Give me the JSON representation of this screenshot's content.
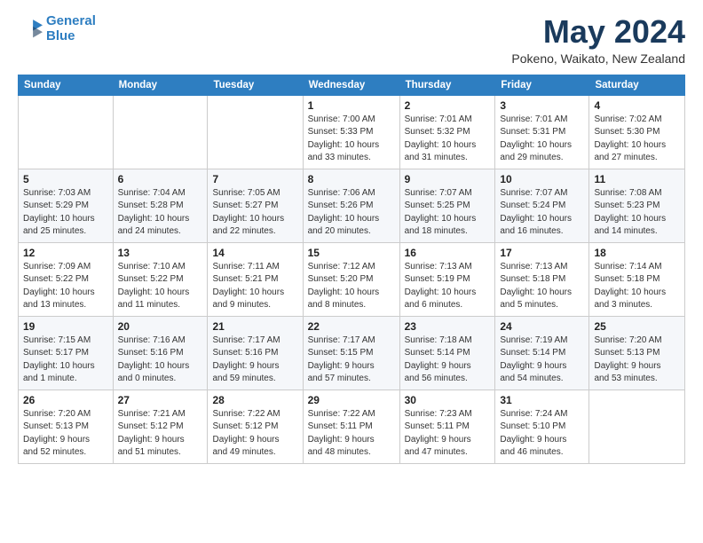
{
  "header": {
    "logo_line1": "General",
    "logo_line2": "Blue",
    "month": "May 2024",
    "location": "Pokeno, Waikato, New Zealand"
  },
  "days_of_week": [
    "Sunday",
    "Monday",
    "Tuesday",
    "Wednesday",
    "Thursday",
    "Friday",
    "Saturday"
  ],
  "weeks": [
    [
      {
        "day": "",
        "info": ""
      },
      {
        "day": "",
        "info": ""
      },
      {
        "day": "",
        "info": ""
      },
      {
        "day": "1",
        "info": "Sunrise: 7:00 AM\nSunset: 5:33 PM\nDaylight: 10 hours\nand 33 minutes."
      },
      {
        "day": "2",
        "info": "Sunrise: 7:01 AM\nSunset: 5:32 PM\nDaylight: 10 hours\nand 31 minutes."
      },
      {
        "day": "3",
        "info": "Sunrise: 7:01 AM\nSunset: 5:31 PM\nDaylight: 10 hours\nand 29 minutes."
      },
      {
        "day": "4",
        "info": "Sunrise: 7:02 AM\nSunset: 5:30 PM\nDaylight: 10 hours\nand 27 minutes."
      }
    ],
    [
      {
        "day": "5",
        "info": "Sunrise: 7:03 AM\nSunset: 5:29 PM\nDaylight: 10 hours\nand 25 minutes."
      },
      {
        "day": "6",
        "info": "Sunrise: 7:04 AM\nSunset: 5:28 PM\nDaylight: 10 hours\nand 24 minutes."
      },
      {
        "day": "7",
        "info": "Sunrise: 7:05 AM\nSunset: 5:27 PM\nDaylight: 10 hours\nand 22 minutes."
      },
      {
        "day": "8",
        "info": "Sunrise: 7:06 AM\nSunset: 5:26 PM\nDaylight: 10 hours\nand 20 minutes."
      },
      {
        "day": "9",
        "info": "Sunrise: 7:07 AM\nSunset: 5:25 PM\nDaylight: 10 hours\nand 18 minutes."
      },
      {
        "day": "10",
        "info": "Sunrise: 7:07 AM\nSunset: 5:24 PM\nDaylight: 10 hours\nand 16 minutes."
      },
      {
        "day": "11",
        "info": "Sunrise: 7:08 AM\nSunset: 5:23 PM\nDaylight: 10 hours\nand 14 minutes."
      }
    ],
    [
      {
        "day": "12",
        "info": "Sunrise: 7:09 AM\nSunset: 5:22 PM\nDaylight: 10 hours\nand 13 minutes."
      },
      {
        "day": "13",
        "info": "Sunrise: 7:10 AM\nSunset: 5:22 PM\nDaylight: 10 hours\nand 11 minutes."
      },
      {
        "day": "14",
        "info": "Sunrise: 7:11 AM\nSunset: 5:21 PM\nDaylight: 10 hours\nand 9 minutes."
      },
      {
        "day": "15",
        "info": "Sunrise: 7:12 AM\nSunset: 5:20 PM\nDaylight: 10 hours\nand 8 minutes."
      },
      {
        "day": "16",
        "info": "Sunrise: 7:13 AM\nSunset: 5:19 PM\nDaylight: 10 hours\nand 6 minutes."
      },
      {
        "day": "17",
        "info": "Sunrise: 7:13 AM\nSunset: 5:18 PM\nDaylight: 10 hours\nand 5 minutes."
      },
      {
        "day": "18",
        "info": "Sunrise: 7:14 AM\nSunset: 5:18 PM\nDaylight: 10 hours\nand 3 minutes."
      }
    ],
    [
      {
        "day": "19",
        "info": "Sunrise: 7:15 AM\nSunset: 5:17 PM\nDaylight: 10 hours\nand 1 minute."
      },
      {
        "day": "20",
        "info": "Sunrise: 7:16 AM\nSunset: 5:16 PM\nDaylight: 10 hours\nand 0 minutes."
      },
      {
        "day": "21",
        "info": "Sunrise: 7:17 AM\nSunset: 5:16 PM\nDaylight: 9 hours\nand 59 minutes."
      },
      {
        "day": "22",
        "info": "Sunrise: 7:17 AM\nSunset: 5:15 PM\nDaylight: 9 hours\nand 57 minutes."
      },
      {
        "day": "23",
        "info": "Sunrise: 7:18 AM\nSunset: 5:14 PM\nDaylight: 9 hours\nand 56 minutes."
      },
      {
        "day": "24",
        "info": "Sunrise: 7:19 AM\nSunset: 5:14 PM\nDaylight: 9 hours\nand 54 minutes."
      },
      {
        "day": "25",
        "info": "Sunrise: 7:20 AM\nSunset: 5:13 PM\nDaylight: 9 hours\nand 53 minutes."
      }
    ],
    [
      {
        "day": "26",
        "info": "Sunrise: 7:20 AM\nSunset: 5:13 PM\nDaylight: 9 hours\nand 52 minutes."
      },
      {
        "day": "27",
        "info": "Sunrise: 7:21 AM\nSunset: 5:12 PM\nDaylight: 9 hours\nand 51 minutes."
      },
      {
        "day": "28",
        "info": "Sunrise: 7:22 AM\nSunset: 5:12 PM\nDaylight: 9 hours\nand 49 minutes."
      },
      {
        "day": "29",
        "info": "Sunrise: 7:22 AM\nSunset: 5:11 PM\nDaylight: 9 hours\nand 48 minutes."
      },
      {
        "day": "30",
        "info": "Sunrise: 7:23 AM\nSunset: 5:11 PM\nDaylight: 9 hours\nand 47 minutes."
      },
      {
        "day": "31",
        "info": "Sunrise: 7:24 AM\nSunset: 5:10 PM\nDaylight: 9 hours\nand 46 minutes."
      },
      {
        "day": "",
        "info": ""
      }
    ]
  ]
}
